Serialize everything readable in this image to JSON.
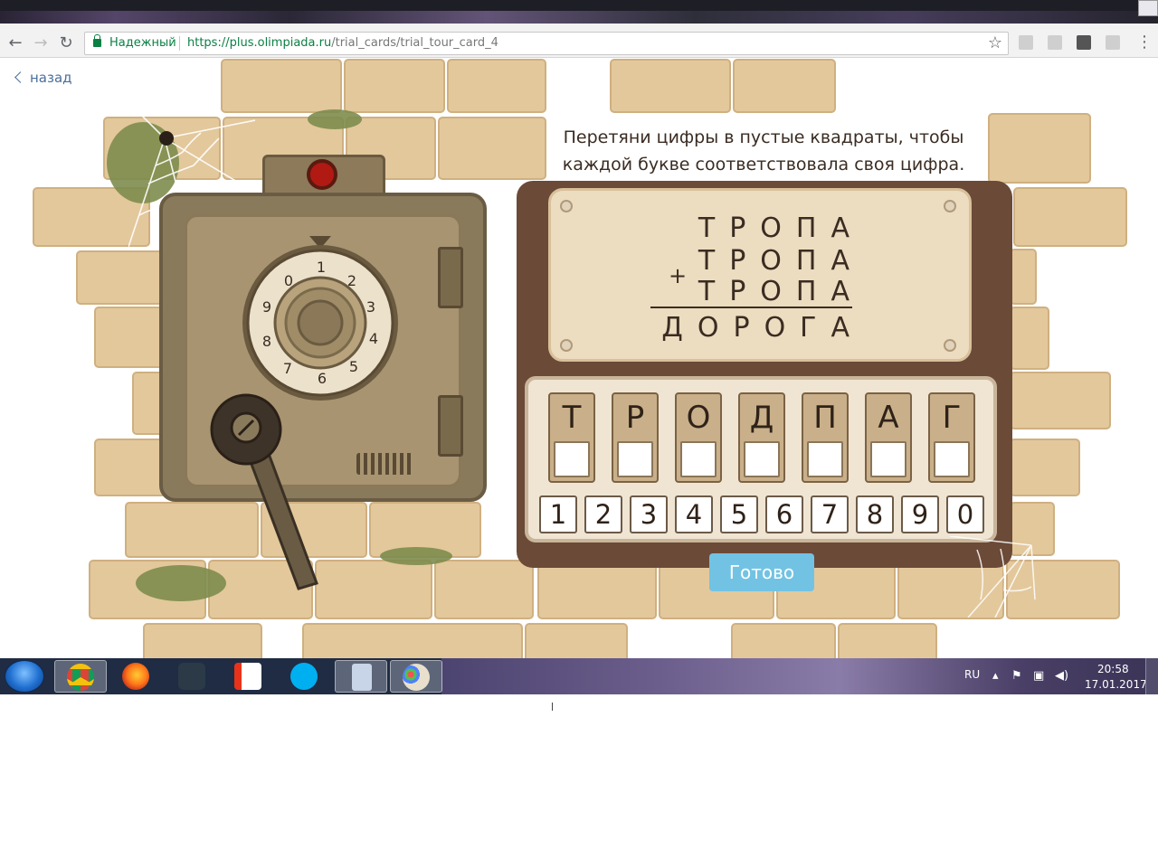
{
  "browser": {
    "secure_label": "Надежный",
    "url_scheme": "https://",
    "url_host": "plus.olimpiada.ru",
    "url_path": "/trial_cards/trial_tour_card_4",
    "nav_back_icon": "arrow-back-icon",
    "nav_forward_icon": "arrow-forward-icon",
    "reload_icon": "reload-icon",
    "bookmark_icon": "star-icon"
  },
  "page": {
    "back_label": "назад",
    "instruction_line1": "Перетяни цифры в пустые квадраты, чтобы",
    "instruction_line2": "каждой букве соответствовала своя цифра."
  },
  "equation": {
    "operand1": "ТРОПА",
    "operand2": "ТРОПА",
    "operand3": "ТРОПА",
    "operator": "+",
    "result": "ДОРОГА"
  },
  "letters": [
    "Т",
    "Р",
    "О",
    "Д",
    "П",
    "А",
    "Г"
  ],
  "digits": [
    "1",
    "2",
    "3",
    "4",
    "5",
    "6",
    "7",
    "8",
    "9",
    "0"
  ],
  "safe_dial_numbers": [
    "0",
    "1",
    "2",
    "3",
    "4",
    "5",
    "6",
    "7",
    "8",
    "9"
  ],
  "submit_label": "Готово",
  "colors": {
    "brick": "#e3c89c",
    "safe": "#8a7a5c",
    "plaque": "#ecdcc0",
    "submit_button": "#72c3e3",
    "secure_green": "#0b8043",
    "back_link": "#4a6f9c"
  },
  "taskbar": {
    "language": "RU",
    "time": "20:58",
    "date": "17.01.2017",
    "apps": [
      "chrome-icon",
      "firefox-icon",
      "nox-icon",
      "yandex-browser-icon",
      "skype-icon",
      "calculator-icon",
      "paint-icon"
    ]
  }
}
